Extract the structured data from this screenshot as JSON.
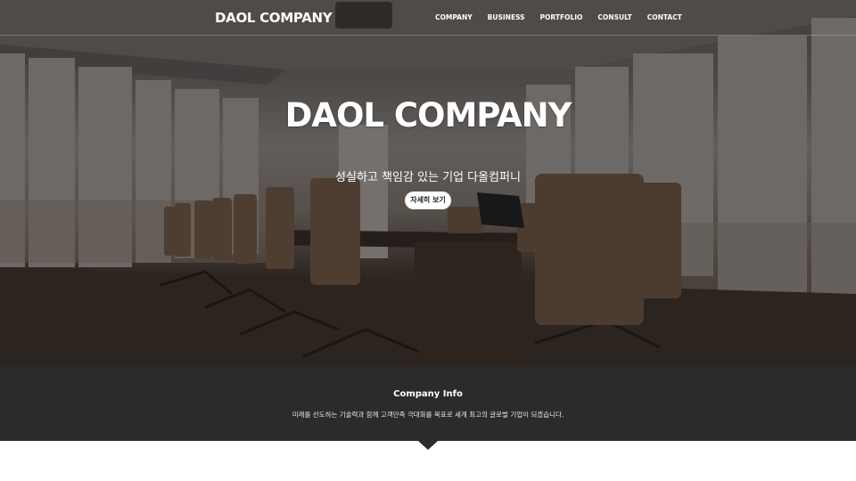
{
  "nav": {
    "logo": "DAOL COMPANY",
    "items": [
      {
        "label": "COMPANY"
      },
      {
        "label": "BUSINESS"
      },
      {
        "label": "PORTFOLIO"
      },
      {
        "label": "CONSULT"
      },
      {
        "label": "CONTACT"
      }
    ]
  },
  "hero": {
    "title": "DAOL COMPANY",
    "subtitle": "성실하고 책임감 있는 기업 다올컴퍼니",
    "button_label": "자세히 보기"
  },
  "info": {
    "title": "Company Info",
    "description": "미래를 선도하는 기술력과 함께 고객만족 극대화를 목표로 세계 최고의 글로벌 기업이 되겠습니다."
  },
  "colors": {
    "band": "#2b2b2b",
    "text": "#ffffff",
    "button_bg": "#ffffff"
  }
}
